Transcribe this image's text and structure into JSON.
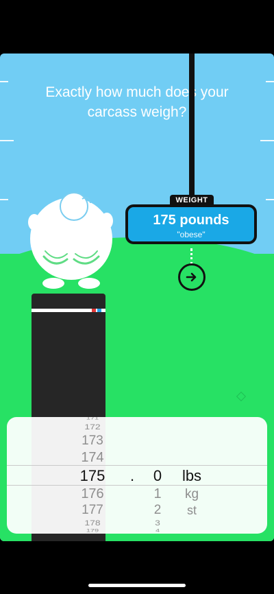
{
  "screen": {
    "question": "Exactly how much does your carcass weigh?"
  },
  "weight": {
    "tag": "WEIGHT",
    "value": "175 pounds",
    "note": "\"obese\""
  },
  "picker": {
    "number_col": [
      "171",
      "172",
      "173",
      "174",
      "175",
      "176",
      "177",
      "178",
      "179"
    ],
    "decimal_sep": ".",
    "decimal_col": [
      "0",
      "1",
      "2",
      "3",
      "4"
    ],
    "unit_col": [
      "lbs",
      "kg",
      "st"
    ],
    "selected": {
      "number": "175",
      "decimal": "0",
      "unit": "lbs"
    }
  },
  "colors": {
    "sky": "#71cdf4",
    "ground": "#27e164",
    "accent_box": "#1aa8e6",
    "dark": "#111111"
  },
  "icons": {
    "next": "arrow-right-circle-icon",
    "character": "character-head-icon",
    "hint": "diamond-hint-icon"
  }
}
